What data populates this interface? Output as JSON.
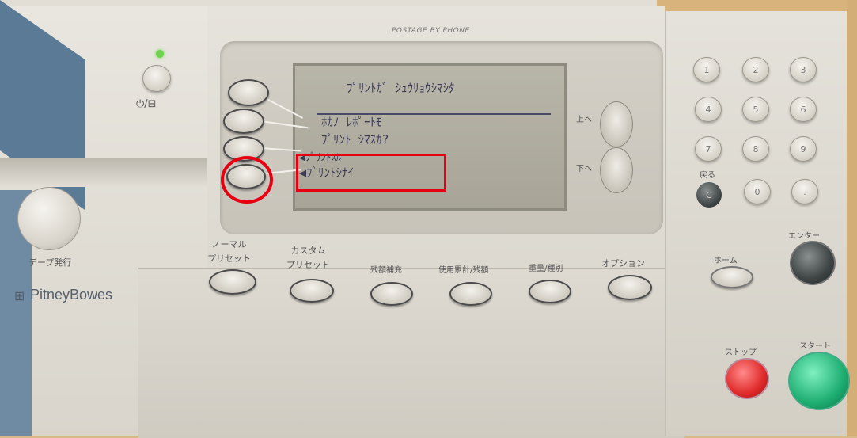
{
  "brand": "POSTAGE BY PHONE",
  "logo": "PitneyBowes",
  "lcd": {
    "title": "ﾌﾟﾘﾝﾄｶﾞ ｼｭｳﾘｮｳｼﾏｼﾀ",
    "line1": "ﾎｶﾉ ﾚﾎﾟｰﾄﾓ",
    "line2": "ﾌﾟﾘﾝﾄ ｼﾏｽｶ?",
    "option1": "◀ﾌﾟﾘﾝﾄｽﾙ",
    "option2": "◀ﾌﾟﾘﾝﾄｼﾅｲ"
  },
  "nav": {
    "up": "上へ",
    "down": "下へ"
  },
  "left": {
    "power": "⏻/⊟",
    "tape": "テープ発行"
  },
  "function_buttons": [
    {
      "label": "ノーマル\nプリセット"
    },
    {
      "label": "カスタム\nプリセット"
    },
    {
      "label": "残額補充"
    },
    {
      "label": "使用累計/残額"
    },
    {
      "label": "重量/種別"
    },
    {
      "label": "オプション"
    }
  ],
  "keypad": [
    "1",
    "2",
    "3",
    "4",
    "5",
    "6",
    "7",
    "8",
    "9",
    "0",
    "."
  ],
  "keys": {
    "back": "戻る",
    "c": "C",
    "home": "ホーム",
    "enter": "エンター",
    "stop": "ストップ",
    "start": "スタート"
  },
  "colors": {
    "annotation": "#e60012",
    "start": "#1eae72",
    "stop": "#e02a2a"
  }
}
